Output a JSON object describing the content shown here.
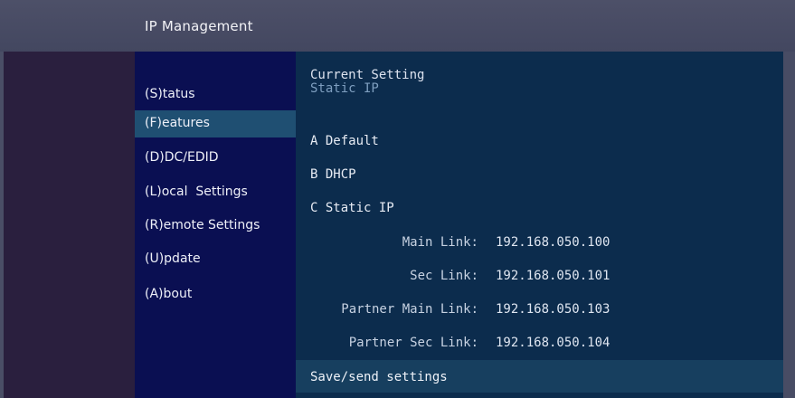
{
  "window": {
    "title": "IP Management"
  },
  "sidebar": {
    "items": [
      {
        "label": "(S)tatus",
        "selected": false
      },
      {
        "label": "(F)eatures",
        "selected": true
      },
      {
        "label": "(D)DC/EDID",
        "selected": false
      },
      {
        "label": "(L)ocal  Settings",
        "selected": false
      },
      {
        "label": "(R)emote Settings",
        "selected": false
      },
      {
        "label": "(U)pdate",
        "selected": false
      },
      {
        "label": "(A)bout",
        "selected": false
      }
    ]
  },
  "main": {
    "current_setting_label": "Current Setting",
    "current_setting_value": "Static IP",
    "options": [
      {
        "label": "A Default"
      },
      {
        "label": "B DHCP"
      },
      {
        "label": "C Static IP"
      }
    ],
    "fields": [
      {
        "label": "Main Link:",
        "value": "192.168.050.100"
      },
      {
        "label": "Sec Link:",
        "value": "192.168.050.101"
      },
      {
        "label": "Partner Main Link:",
        "value": "192.168.050.103"
      },
      {
        "label": "Partner Sec Link:",
        "value": "192.168.050.104"
      }
    ],
    "save_label": "Save/send settings"
  },
  "colors": {
    "sidebar_bg": "#0a0f52",
    "selected_bg": "#1f4f72",
    "main_bg": "#0c2c4d",
    "save_row_bg": "#173f5f",
    "title_bar": "#4a4e66"
  }
}
